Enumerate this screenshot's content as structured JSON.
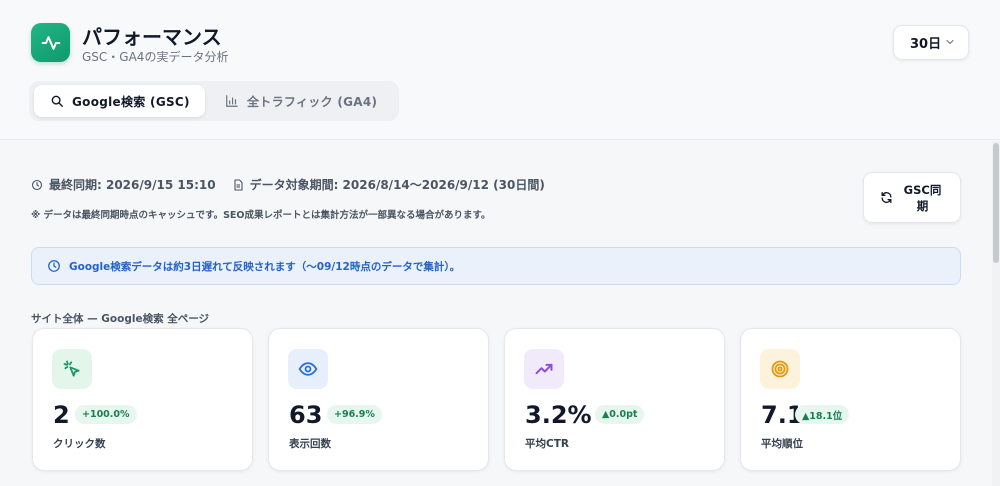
{
  "header": {
    "title": "パフォーマンス",
    "subtitle": "GSC・GA4の実データ分析",
    "period_select": {
      "value": "30日"
    }
  },
  "tabs": [
    {
      "label": "Google検索 (GSC)",
      "active": true,
      "icon": "search-icon"
    },
    {
      "label": "全トラフィック (GA4)",
      "active": false,
      "icon": "bar-chart-icon"
    }
  ],
  "meta": {
    "last_sync": "最終同期: 2026/9/15 15:10",
    "data_period": "データ対象期間: 2026/8/14〜2026/9/12 (30日間)",
    "note": "※ データは最終同期時点のキャッシュです。SEO成果レポートとは集計方法が一部異なる場合があります。"
  },
  "sync_button": {
    "label": "GSC同期"
  },
  "banner": {
    "text": "Google検索データは約3日遅れて反映されます（〜09/12時点のデータで集計）。"
  },
  "section_label": "サイト全体 — Google検索 全ページ",
  "cards": [
    {
      "value": "2",
      "delta": "+100.0%",
      "label": "クリック数",
      "icon": "cursor-click-icon"
    },
    {
      "value": "63",
      "delta": "+96.9%",
      "label": "表示回数",
      "icon": "eye-icon"
    },
    {
      "value": "3.2%",
      "delta": "▲0.0pt",
      "label": "平均CTR",
      "icon": "trend-up-icon"
    },
    {
      "value": "7.1",
      "delta": "▲18.1位",
      "label": "平均順位",
      "icon": "target-icon"
    }
  ],
  "colors": {
    "brand": "#17a777",
    "banner_text": "#2563c9",
    "positive": "#16804f"
  }
}
